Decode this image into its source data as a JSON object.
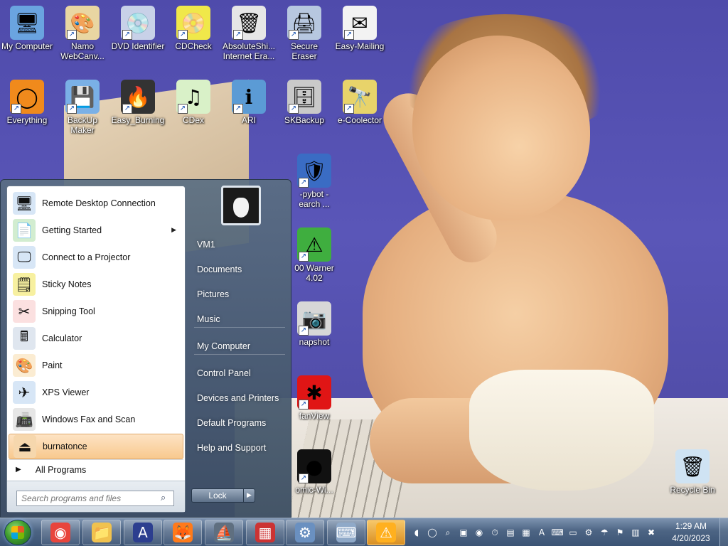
{
  "desktop_icons": [
    {
      "label": "My Computer",
      "icon": "computer-icon",
      "color": "#6aa4e0",
      "glyph": "🖥"
    },
    {
      "label": "Namo WebCanv...",
      "icon": "palette-icon",
      "color": "#e9d6a2",
      "glyph": "🎨"
    },
    {
      "label": "DVD Identifier",
      "icon": "disc-icon",
      "color": "#c8d1e8",
      "glyph": "💿"
    },
    {
      "label": "CDCheck",
      "icon": "cd-check-icon",
      "color": "#f0e84a",
      "glyph": "📀"
    },
    {
      "label": "AbsoluteShi... Internet Era...",
      "icon": "shredder-icon",
      "color": "#e6e6e6",
      "glyph": "🗑"
    },
    {
      "label": "Secure Eraser",
      "icon": "printer-icon",
      "color": "#b7c7e0",
      "glyph": "🖨"
    },
    {
      "label": "Easy-Mailing",
      "icon": "mail-icon",
      "color": "#f3f3f3",
      "glyph": "✉"
    },
    {
      "label": "Everything",
      "icon": "search-ring-icon",
      "color": "#f08a1c",
      "glyph": "◯"
    },
    {
      "label": "BackUp Maker",
      "icon": "backup-icon",
      "color": "#7ab0e6",
      "glyph": "💾"
    },
    {
      "label": "Easy_Burning",
      "icon": "burning-icon",
      "color": "#333333",
      "glyph": "🔥"
    },
    {
      "label": "CDex",
      "icon": "cdex-icon",
      "color": "#d9f1c8",
      "glyph": "♫"
    },
    {
      "label": "ARI",
      "icon": "info-shield-icon",
      "color": "#5b9bd5",
      "glyph": "ℹ"
    },
    {
      "label": "SKBackup",
      "icon": "harddrive-icon",
      "color": "#c9c9c9",
      "glyph": "🗄"
    },
    {
      "label": "e-Coolector",
      "icon": "binoculars-icon",
      "color": "#e8d36a",
      "glyph": "🔭"
    },
    {
      "label": "-pybot - earch ...",
      "icon": "spybot-icon",
      "color": "#3a6cc4",
      "glyph": "🛡"
    },
    {
      "label": "00 Warner 4.02",
      "icon": "warning-icon",
      "color": "#3fae3f",
      "glyph": "⚠"
    },
    {
      "label": "napshot",
      "icon": "snapshot-icon",
      "color": "#d7d7d7",
      "glyph": "📷"
    },
    {
      "label": "fanView",
      "icon": "irfanview-icon",
      "color": "#e01515",
      "glyph": "✱"
    },
    {
      "label": "omic-Wi...",
      "icon": "globe-icon",
      "color": "#111111",
      "glyph": "●"
    },
    {
      "label": "Recycle Bin",
      "icon": "recycle-bin-icon",
      "color": "#cfe3f3",
      "glyph": "🗑"
    }
  ],
  "start_menu": {
    "programs": [
      {
        "label": "Remote Desktop Connection",
        "icon": "remote-desktop-icon",
        "glyph": "🖥",
        "color": "#d7e6f6",
        "submenu": false,
        "selected": false
      },
      {
        "label": "Getting Started",
        "icon": "getting-started-icon",
        "glyph": "📄",
        "color": "#d2edd0",
        "submenu": true,
        "selected": false
      },
      {
        "label": "Connect to a Projector",
        "icon": "projector-icon",
        "glyph": "🖵",
        "color": "#d7e6f6",
        "submenu": false,
        "selected": false
      },
      {
        "label": "Sticky Notes",
        "icon": "sticky-notes-icon",
        "glyph": "🗒",
        "color": "#f7f0a0",
        "submenu": false,
        "selected": false
      },
      {
        "label": "Snipping Tool",
        "icon": "scissors-icon",
        "glyph": "✂",
        "color": "#fbe0e0",
        "submenu": false,
        "selected": false
      },
      {
        "label": "Calculator",
        "icon": "calculator-icon",
        "glyph": "🖩",
        "color": "#dfe6ef",
        "submenu": false,
        "selected": false
      },
      {
        "label": "Paint",
        "icon": "paint-icon",
        "glyph": "🎨",
        "color": "#fbecd2",
        "submenu": false,
        "selected": false
      },
      {
        "label": "XPS Viewer",
        "icon": "xps-viewer-icon",
        "glyph": "✈",
        "color": "#d7e6f6",
        "submenu": false,
        "selected": false
      },
      {
        "label": "Windows Fax and Scan",
        "icon": "fax-icon",
        "glyph": "📠",
        "color": "#e6e6e6",
        "submenu": false,
        "selected": false
      },
      {
        "label": "burnatonce",
        "icon": "burnatonce-icon",
        "glyph": "⏏",
        "color": "#f6d7ad",
        "submenu": false,
        "selected": true
      }
    ],
    "all_programs": "All Programs",
    "search_placeholder": "Search programs and files",
    "right_links": [
      "VM1",
      "Documents",
      "Pictures",
      "Music",
      "My Computer",
      "Control Panel",
      "Devices and Printers",
      "Default Programs",
      "Help and Support"
    ],
    "lock_label": "Lock"
  },
  "taskbar": {
    "apps": [
      {
        "name": "chrome",
        "icon": "chrome-icon",
        "glyph": "◉",
        "color": "#e8453c",
        "active": false
      },
      {
        "name": "explorer",
        "icon": "folder-icon",
        "glyph": "📁",
        "color": "#f1c24e",
        "active": false
      },
      {
        "name": "app-a",
        "icon": "a-logo-icon",
        "glyph": "A",
        "color": "#2c3e8f",
        "active": false
      },
      {
        "name": "firefox",
        "icon": "firefox-icon",
        "glyph": "🦊",
        "color": "#ff7a1a",
        "active": false
      },
      {
        "name": "app-sail",
        "icon": "sail-icon",
        "glyph": "⛵",
        "color": "#5f6f80",
        "active": false
      },
      {
        "name": "app-circuit",
        "icon": "circuit-icon",
        "glyph": "▦",
        "color": "#c33",
        "active": false
      },
      {
        "name": "app-control",
        "icon": "control-panel-icon",
        "glyph": "⚙",
        "color": "#6a90c0",
        "active": false
      },
      {
        "name": "app-keyboard",
        "icon": "keyboard-icon",
        "glyph": "⌨",
        "color": "#8fa9c8",
        "active": false
      },
      {
        "name": "app-warning",
        "icon": "warning-check-icon",
        "glyph": "⚠",
        "color": "#ffb01f",
        "active": true
      }
    ],
    "tray": [
      "sound-icon",
      "chat-icon",
      "search-icon",
      "network-icon",
      "shield-icon",
      "clock-tray-icon",
      "drive-icon",
      "windows-icon",
      "a-tray-icon",
      "keyboard-tray-icon",
      "film-icon",
      "gear-tray-icon",
      "umbrella-icon",
      "flag-icon",
      "devices-icon",
      "mute-icon"
    ],
    "clock_time": "1:29 AM",
    "clock_date": "4/20/2023"
  }
}
